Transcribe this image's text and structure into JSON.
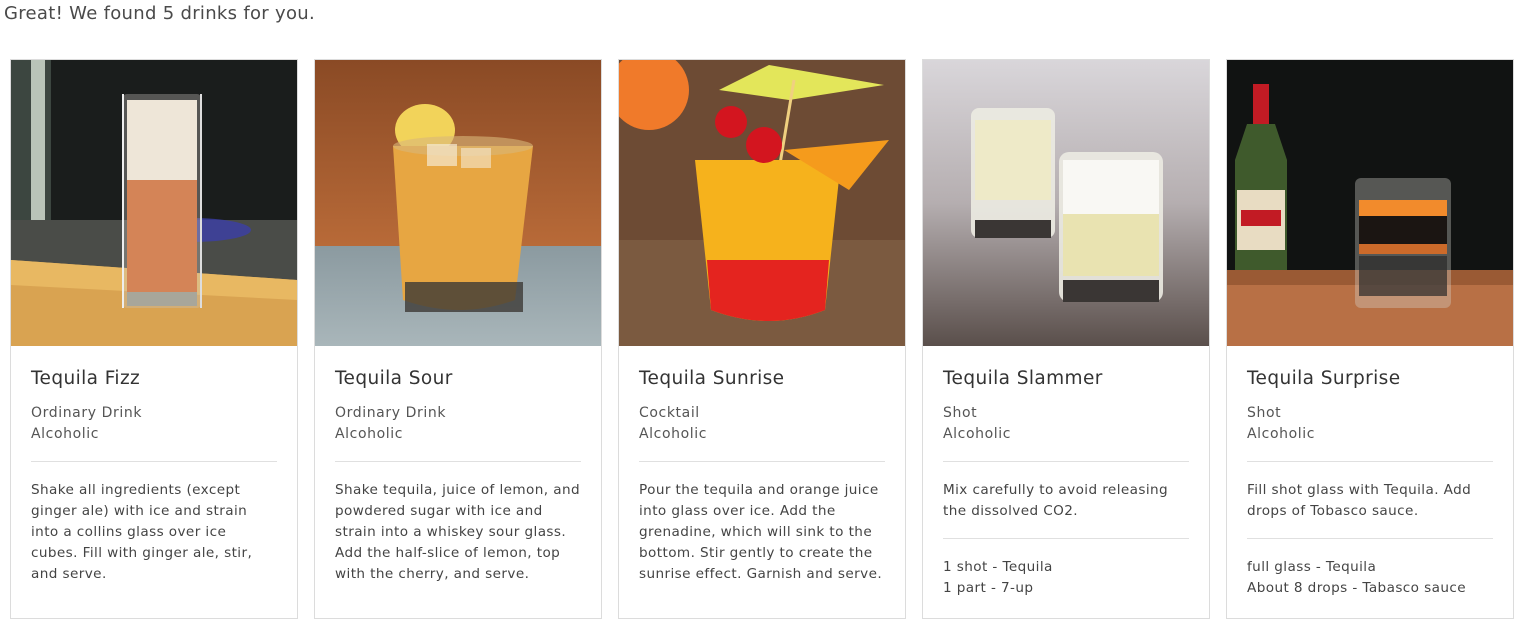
{
  "headline": "Great! We found 5 drinks for you.",
  "drinks": [
    {
      "name": "Tequila Fizz",
      "category": "Ordinary Drink",
      "alcoholic": "Alcoholic",
      "instructions": "Shake all ingredients (except ginger ale) with ice and strain into a collins glass over ice cubes. Fill with ginger ale, stir, and serve.",
      "ingredients": []
    },
    {
      "name": "Tequila Sour",
      "category": "Ordinary Drink",
      "alcoholic": "Alcoholic",
      "instructions": "Shake tequila, juice of lemon, and powdered sugar with ice and strain into a whiskey sour glass. Add the half-slice of lemon, top with the cherry, and serve.",
      "ingredients": []
    },
    {
      "name": "Tequila Sunrise",
      "category": "Cocktail",
      "alcoholic": "Alcoholic",
      "instructions": "Pour the tequila and orange juice into glass over ice. Add the grenadine, which will sink to the bottom. Stir gently to create the sunrise effect. Garnish and serve.",
      "ingredients": []
    },
    {
      "name": "Tequila Slammer",
      "category": "Shot",
      "alcoholic": "Alcoholic",
      "instructions": "Mix carefully to avoid releasing the dissolved CO2.",
      "ingredients": [
        "1 shot - Tequila",
        "1 part - 7-up"
      ]
    },
    {
      "name": "Tequila Surprise",
      "category": "Shot",
      "alcoholic": "Alcoholic",
      "instructions": "Fill shot glass with Tequila. Add drops of Tobasco sauce.",
      "ingredients": [
        "full glass - Tequila",
        "About 8 drops - Tabasco sauce"
      ]
    }
  ]
}
